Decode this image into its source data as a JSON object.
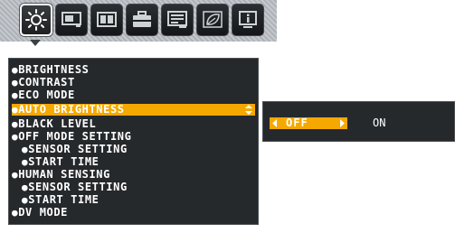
{
  "icon_tabs": [
    {
      "name": "brightness-settings-icon",
      "active": true
    },
    {
      "name": "screen-size-icon",
      "active": false
    },
    {
      "name": "color-settings-icon",
      "active": false
    },
    {
      "name": "tools-icon",
      "active": false
    },
    {
      "name": "menu-tools-icon",
      "active": false
    },
    {
      "name": "eco-icon",
      "active": false
    },
    {
      "name": "information-icon",
      "active": false
    }
  ],
  "menu": {
    "items": [
      {
        "label": "BRIGHTNESS"
      },
      {
        "label": "CONTRAST"
      },
      {
        "label": "ECO MODE"
      },
      {
        "label": "AUTO BRIGHTNESS",
        "selected": true
      },
      {
        "label": "BLACK LEVEL"
      },
      {
        "label": "OFF MODE SETTING"
      },
      {
        "label": "SENSOR SETTING",
        "sub": true
      },
      {
        "label": "START TIME",
        "sub": true
      },
      {
        "label": "HUMAN SENSING"
      },
      {
        "label": "SENSOR SETTING",
        "sub": true
      },
      {
        "label": "START TIME",
        "sub": true
      },
      {
        "label": "DV MODE"
      }
    ]
  },
  "submenu": {
    "selected_option": "OFF",
    "other_option": "ON"
  },
  "colors": {
    "highlight": "#f5a800",
    "panel_bg": "#26292c",
    "text": "#ffffff"
  }
}
